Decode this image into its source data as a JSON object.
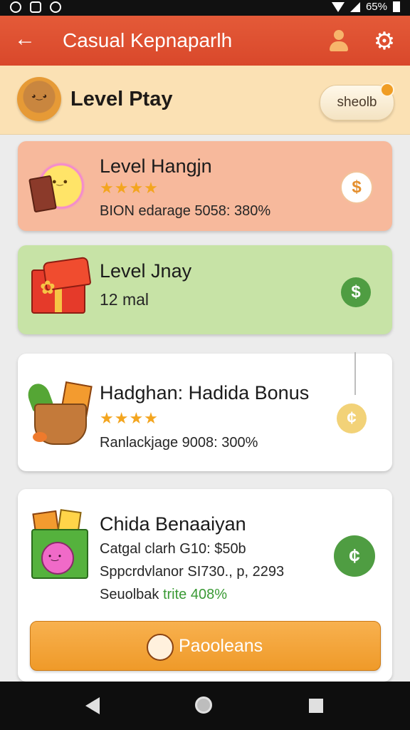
{
  "status_bar": {
    "battery_text": "65%"
  },
  "app_bar": {
    "title": "Casual Kepnaparlh"
  },
  "level_bar": {
    "title": "Level Ptay",
    "shop_button": "sheolb"
  },
  "cards": [
    {
      "title": "Level Hangjn",
      "stars": "★★★★",
      "detail": "BION edarage 5058: 380%",
      "coin": "$",
      "color": "#f7b99c"
    },
    {
      "title": "Level Jnay",
      "detail": "12 mal",
      "coin": "$",
      "color": "#c7e3a6"
    },
    {
      "title": "Hadghan: Hadida Bonus",
      "stars": "★★★★",
      "detail": "Ranlackjage 9008: 300%",
      "coin": "¢",
      "color": "#ffffff"
    },
    {
      "title": "Chida Benaaiyan",
      "line1": "Catgal clarh G10: $50b",
      "line2": "Sppcrdvlanor SI730., p, 2293",
      "line3_prefix": "Seuolbak ",
      "line3_highlight": "trite 408%",
      "coin": "¢",
      "button": "Paooleans",
      "color": "#ffffff"
    }
  ],
  "icons": {
    "back": "back-arrow-icon",
    "profile": "profile-icon",
    "settings": "gear-icon",
    "peach": "peach-icon"
  },
  "colors": {
    "app_bar": "#d9482b",
    "level_bar": "#fbe1b4",
    "accent_orange": "#ef9a29",
    "green": "#4f9d42"
  }
}
